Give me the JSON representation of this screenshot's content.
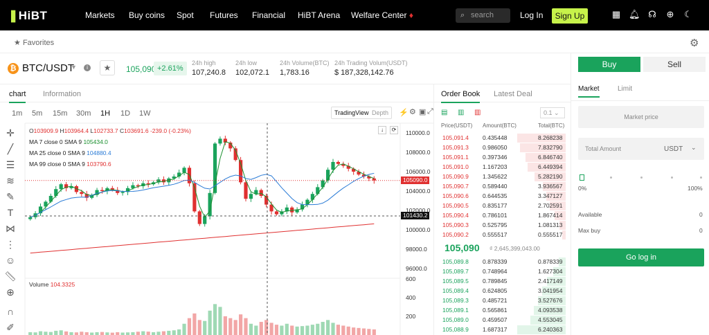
{
  "logo": "HiBT",
  "nav": [
    "Markets",
    "Buy coins",
    "Spot",
    "Futures",
    "Financial",
    "HiBT Arena",
    "Welfare Center"
  ],
  "search_placeholder": "search",
  "login": "Log In",
  "signup": "Sign Up",
  "favorites": "Favorites",
  "pair": "BTC/USDT",
  "last_price": "105,090",
  "change": "+2.61%",
  "stats": [
    {
      "label": "24h high",
      "value": "107,240.8"
    },
    {
      "label": "24h low",
      "value": "102,072.1"
    },
    {
      "label": "24h Volume(BTC)",
      "value": "1,783.16"
    },
    {
      "label": "24h Trading Volum(USDT)",
      "value": "$ 187,328,142.76"
    }
  ],
  "chart_tabs": [
    "chart",
    "Information"
  ],
  "intervals": [
    "1m",
    "5m",
    "15m",
    "30m",
    "1H",
    "1D",
    "1W"
  ],
  "active_interval": "1H",
  "view_modes": [
    "TradingView",
    "Depth"
  ],
  "ohlc": {
    "o": "103909.9",
    "h": "103964.4",
    "l": "102733.7",
    "c": "103691.6",
    "chg": "-239.0 (-0.23%)"
  },
  "ma": [
    {
      "label": "MA 7 close 0 SMA 9",
      "value": "105434.0",
      "color": "#1a8f2e"
    },
    {
      "label": "MA 25 close 0 SMA 9",
      "value": "104880.4",
      "color": "#2a7bd6"
    },
    {
      "label": "MA 99 close 0 SMA 9",
      "value": "103790.6",
      "color": "#e03030"
    }
  ],
  "volume_label": "Volume",
  "volume_value": "104.3325",
  "price_axis": [
    "110000.0",
    "108000.0",
    "106000.0",
    "104000.0",
    "102000.0",
    "100000.0",
    "98000.0",
    "96000.0"
  ],
  "price_axis_tags": {
    "last": "105090.0",
    "cross": "101430.2"
  },
  "volume_axis": [
    "600",
    "400",
    "200"
  ],
  "chart_data": {
    "type": "candlestick",
    "interval": "1H",
    "price_range": [
      95000,
      111000
    ],
    "last": 105090,
    "crosshair": 101430.2,
    "closes": [
      101300,
      101700,
      102400,
      102900,
      103500,
      104200,
      104700,
      104300,
      104500,
      103900,
      103700,
      103300,
      103600,
      104100,
      104000,
      104300,
      104100,
      103800,
      103900,
      104300,
      104600,
      104500,
      104800,
      104700,
      104900,
      105200,
      104900,
      105300,
      105500,
      105900,
      106400,
      104800,
      101900,
      100600,
      101400,
      103800,
      108900,
      109400,
      109000,
      108400,
      107200,
      104900,
      103200,
      103700,
      104100,
      103500,
      102600,
      101900,
      101600,
      101900,
      102300,
      101800,
      102100,
      102600,
      103100,
      103700,
      104400,
      105100,
      106200,
      107000,
      106800,
      106600,
      106300,
      106000,
      105700,
      105500,
      105300,
      105090
    ],
    "volumes": [
      30,
      28,
      40,
      35,
      32,
      45,
      50,
      38,
      30,
      28,
      35,
      30,
      26,
      30,
      32,
      28,
      25,
      30,
      26,
      28,
      30,
      35,
      40,
      36,
      30,
      35,
      40,
      45,
      50,
      60,
      120,
      180,
      230,
      160,
      150,
      260,
      330,
      300,
      200,
      180,
      160,
      220,
      180,
      120,
      100,
      140,
      160,
      130,
      110,
      100,
      120,
      100,
      90,
      95,
      100,
      110,
      120,
      140,
      160,
      130,
      110,
      100,
      90,
      80,
      75,
      70,
      65,
      60
    ]
  },
  "order_book": {
    "tabs": [
      "Order Book",
      "Latest Deal"
    ],
    "step": "0.1",
    "headers": [
      "Price(USDT)",
      "Amount(BTC)",
      "Total(BTC)"
    ],
    "asks": [
      [
        "105,091.4",
        "0.435448",
        "8.268238"
      ],
      [
        "105,091.3",
        "0.986050",
        "7.832790"
      ],
      [
        "105,091.1",
        "0.397346",
        "6.846740"
      ],
      [
        "105,091.0",
        "1.167203",
        "6.449394"
      ],
      [
        "105,090.9",
        "1.345622",
        "5.282190"
      ],
      [
        "105,090.7",
        "0.589440",
        "3.936567"
      ],
      [
        "105,090.6",
        "0.644535",
        "3.347127"
      ],
      [
        "105,090.5",
        "0.835177",
        "2.702591"
      ],
      [
        "105,090.4",
        "0.786101",
        "1.867414"
      ],
      [
        "105,090.3",
        "0.525795",
        "1.081313"
      ],
      [
        "105,090.2",
        "0.555517",
        "0.555517"
      ]
    ],
    "mid_price": "105,090",
    "mid_sub": "₫ 2,645,399,043.00",
    "bids": [
      [
        "105,089.8",
        "0.878339",
        "0.878339"
      ],
      [
        "105,089.7",
        "0.748964",
        "1.627304"
      ],
      [
        "105,089.5",
        "0.789845",
        "2.417149"
      ],
      [
        "105,089.4",
        "0.624805",
        "3.041954"
      ],
      [
        "105,089.3",
        "0.485721",
        "3.527676"
      ],
      [
        "105,089.1",
        "0.565861",
        "4.093538"
      ],
      [
        "105,089.0",
        "0.459507",
        "4.553045"
      ],
      [
        "105,088.9",
        "1.687317",
        "6.240363"
      ]
    ]
  },
  "trade": {
    "buy": "Buy",
    "sell": "Sell",
    "order_tabs": [
      "Market",
      "Limit"
    ],
    "market_price": "Market price",
    "total_label": "Total Amount",
    "total_unit": "USDT",
    "slider_min": "0%",
    "slider_max": "100%",
    "available_label": "Available",
    "available_value": "0",
    "maxbuy_label": "Max buy",
    "maxbuy_value": "0",
    "go_login": "Go log in"
  },
  "colors": {
    "up": "#1aa35c",
    "down": "#e03030",
    "accent": "#c7f24a"
  }
}
